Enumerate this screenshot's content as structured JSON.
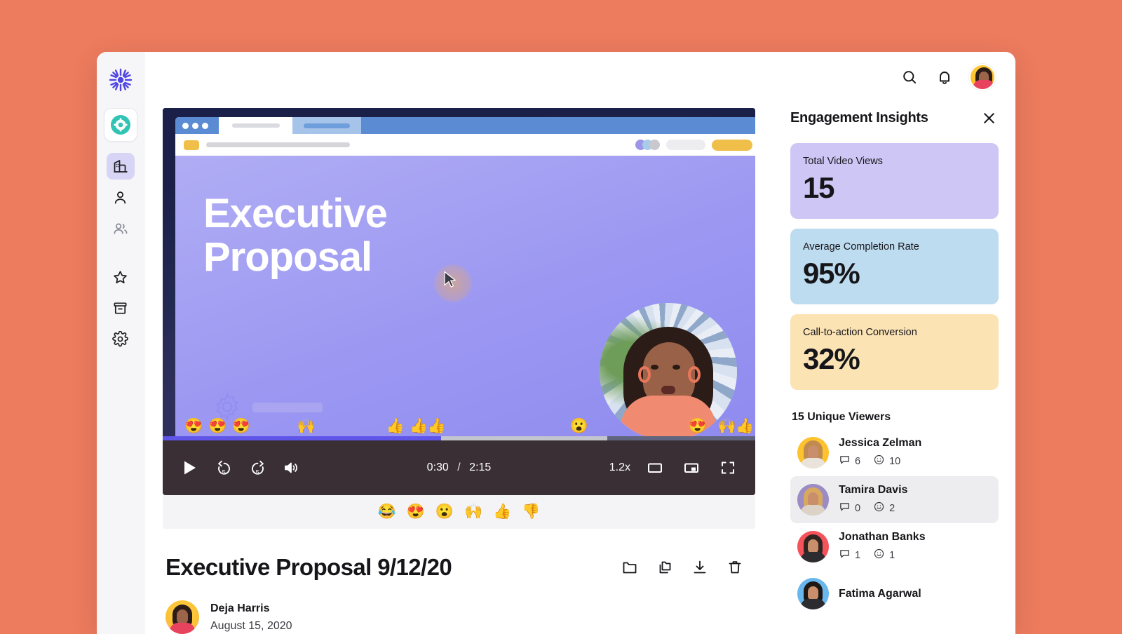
{
  "background_color": "#ED7B5E",
  "sidebar": {
    "logo_icon": "sunburst-logo-icon",
    "workspace_icon": "teal-gear-avatar-icon",
    "items": [
      {
        "icon": "building-icon",
        "name": "sidebar-item-workspace",
        "active": true
      },
      {
        "icon": "person-icon",
        "name": "sidebar-item-my-videos",
        "active": false
      },
      {
        "icon": "people-icon",
        "name": "sidebar-item-shared",
        "active": false
      },
      {
        "icon": "star-icon",
        "name": "sidebar-item-favorites",
        "active": false
      },
      {
        "icon": "archive-icon",
        "name": "sidebar-item-archive",
        "active": false
      },
      {
        "icon": "gear-icon",
        "name": "sidebar-item-settings",
        "active": false
      }
    ]
  },
  "topbar": {
    "search_icon": "search-icon",
    "notifications_icon": "bell-icon",
    "avatar_icon": "user-avatar"
  },
  "video": {
    "slide_title_line1": "Executive",
    "slide_title_line2": "Proposal",
    "current_time": "0:30",
    "separator": "/",
    "duration": "2:15",
    "playback_speed": "1.2x",
    "progress_percent": 47,
    "buffer_percent": 75,
    "controls": {
      "play": "play-icon",
      "rewind": "rewind-5-icon",
      "forward": "forward-5-icon",
      "volume": "volume-icon",
      "theater": "theater-mode-icon",
      "pip": "picture-in-picture-icon",
      "fullscreen": "fullscreen-icon"
    },
    "timeline_reactions": [
      {
        "emoji": "😍",
        "pos": 5
      },
      {
        "emoji": "😍",
        "pos": 9
      },
      {
        "emoji": "😍",
        "pos": 13
      },
      {
        "emoji": "🙌",
        "pos": 24
      },
      {
        "emoji": "👍",
        "pos": 39
      },
      {
        "emoji": "👍",
        "pos": 43
      },
      {
        "emoji": "👍",
        "pos": 46
      },
      {
        "emoji": "😮",
        "pos": 70
      },
      {
        "emoji": "😍",
        "pos": 90
      },
      {
        "emoji": "🙌",
        "pos": 95
      },
      {
        "emoji": "👍",
        "pos": 98
      }
    ],
    "reaction_bar": [
      "😂",
      "😍",
      "😮",
      "🙌",
      "👍",
      "👎"
    ]
  },
  "title_block": {
    "title": "Executive Proposal 9/12/20",
    "actions": [
      {
        "icon": "folder-icon",
        "name": "move-to-folder-button"
      },
      {
        "icon": "copy-icon",
        "name": "duplicate-button"
      },
      {
        "icon": "download-icon",
        "name": "download-button"
      },
      {
        "icon": "trash-icon",
        "name": "delete-button"
      }
    ],
    "author_name": "Deja Harris",
    "author_date": "August 15, 2020"
  },
  "insights": {
    "title": "Engagement Insights",
    "close_icon": "close-icon",
    "cards": [
      {
        "label": "Total Video Views",
        "value": "15",
        "color": "#CEC6F5"
      },
      {
        "label": "Average Completion Rate",
        "value": "95%",
        "color": "#BEDCF0"
      },
      {
        "label": "Call-to-action Conversion",
        "value": "32%",
        "color": "#FBE3B4"
      }
    ],
    "viewers_heading": "15 Unique Viewers",
    "viewers": [
      {
        "name": "Jessica Zelman",
        "comments": "6",
        "reactions": "10",
        "avatar_color": "#FDC22E",
        "hair": "#C18A4E",
        "body": "#E9E3DB",
        "selected": false
      },
      {
        "name": "Tamira Davis",
        "comments": "0",
        "reactions": "2",
        "avatar_color": "#9C8CC4",
        "hair": "#D9A85F",
        "body": "#DCD2C6",
        "selected": true
      },
      {
        "name": "Jonathan Banks",
        "comments": "1",
        "reactions": "1",
        "avatar_color": "#F4535C",
        "hair": "#2F2420",
        "body": "#2B2B30",
        "selected": false
      },
      {
        "name": "Fatima Agarwal",
        "comments": "",
        "reactions": "",
        "avatar_color": "#6AB7EE",
        "hair": "#1E1814",
        "body": "#2B2B30",
        "selected": false
      }
    ],
    "comment_icon": "comment-icon",
    "reaction_icon": "smiley-icon"
  }
}
